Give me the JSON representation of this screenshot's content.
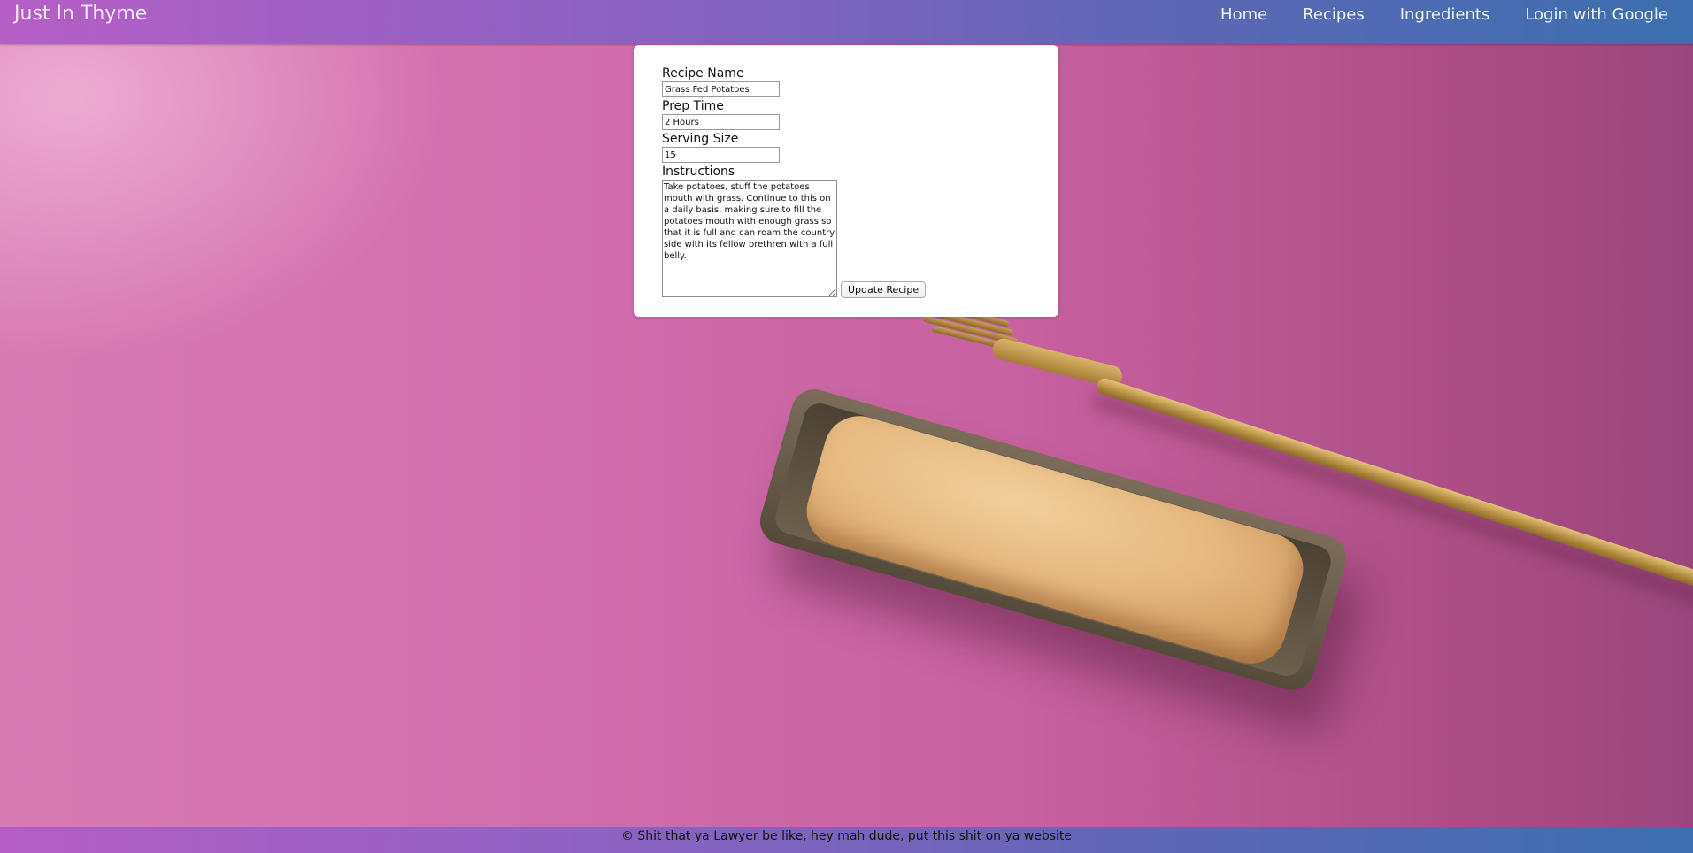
{
  "navbar": {
    "brand": "Just In Thyme",
    "links": [
      "Home",
      "Recipes",
      "Ingredients",
      "Login with Google"
    ]
  },
  "form": {
    "recipe_name_label": "Recipe Name",
    "recipe_name_value": "Grass Fed Potatoes",
    "prep_time_label": "Prep Time",
    "prep_time_value": "2 Hours",
    "serving_size_label": "Serving Size",
    "serving_size_value": "15",
    "instructions_label": "Instructions",
    "instructions_value": "Take potatoes, stuff the potatoes mouth with grass. Continue to this on a daily basis, making sure to fill the potatoes mouth with enough grass so that it is full and can roam the country side with its fellow brethren with a full belly.",
    "submit_label": "Update Recipe"
  },
  "footer": {
    "text": "© Shit that ya Lawyer be like, hey mah dude, put this shit on ya website"
  },
  "colors": {
    "nav_gradient_start": "#b55ec6",
    "nav_gradient_end": "#3c6fae",
    "background_pink": "#d26fae"
  }
}
